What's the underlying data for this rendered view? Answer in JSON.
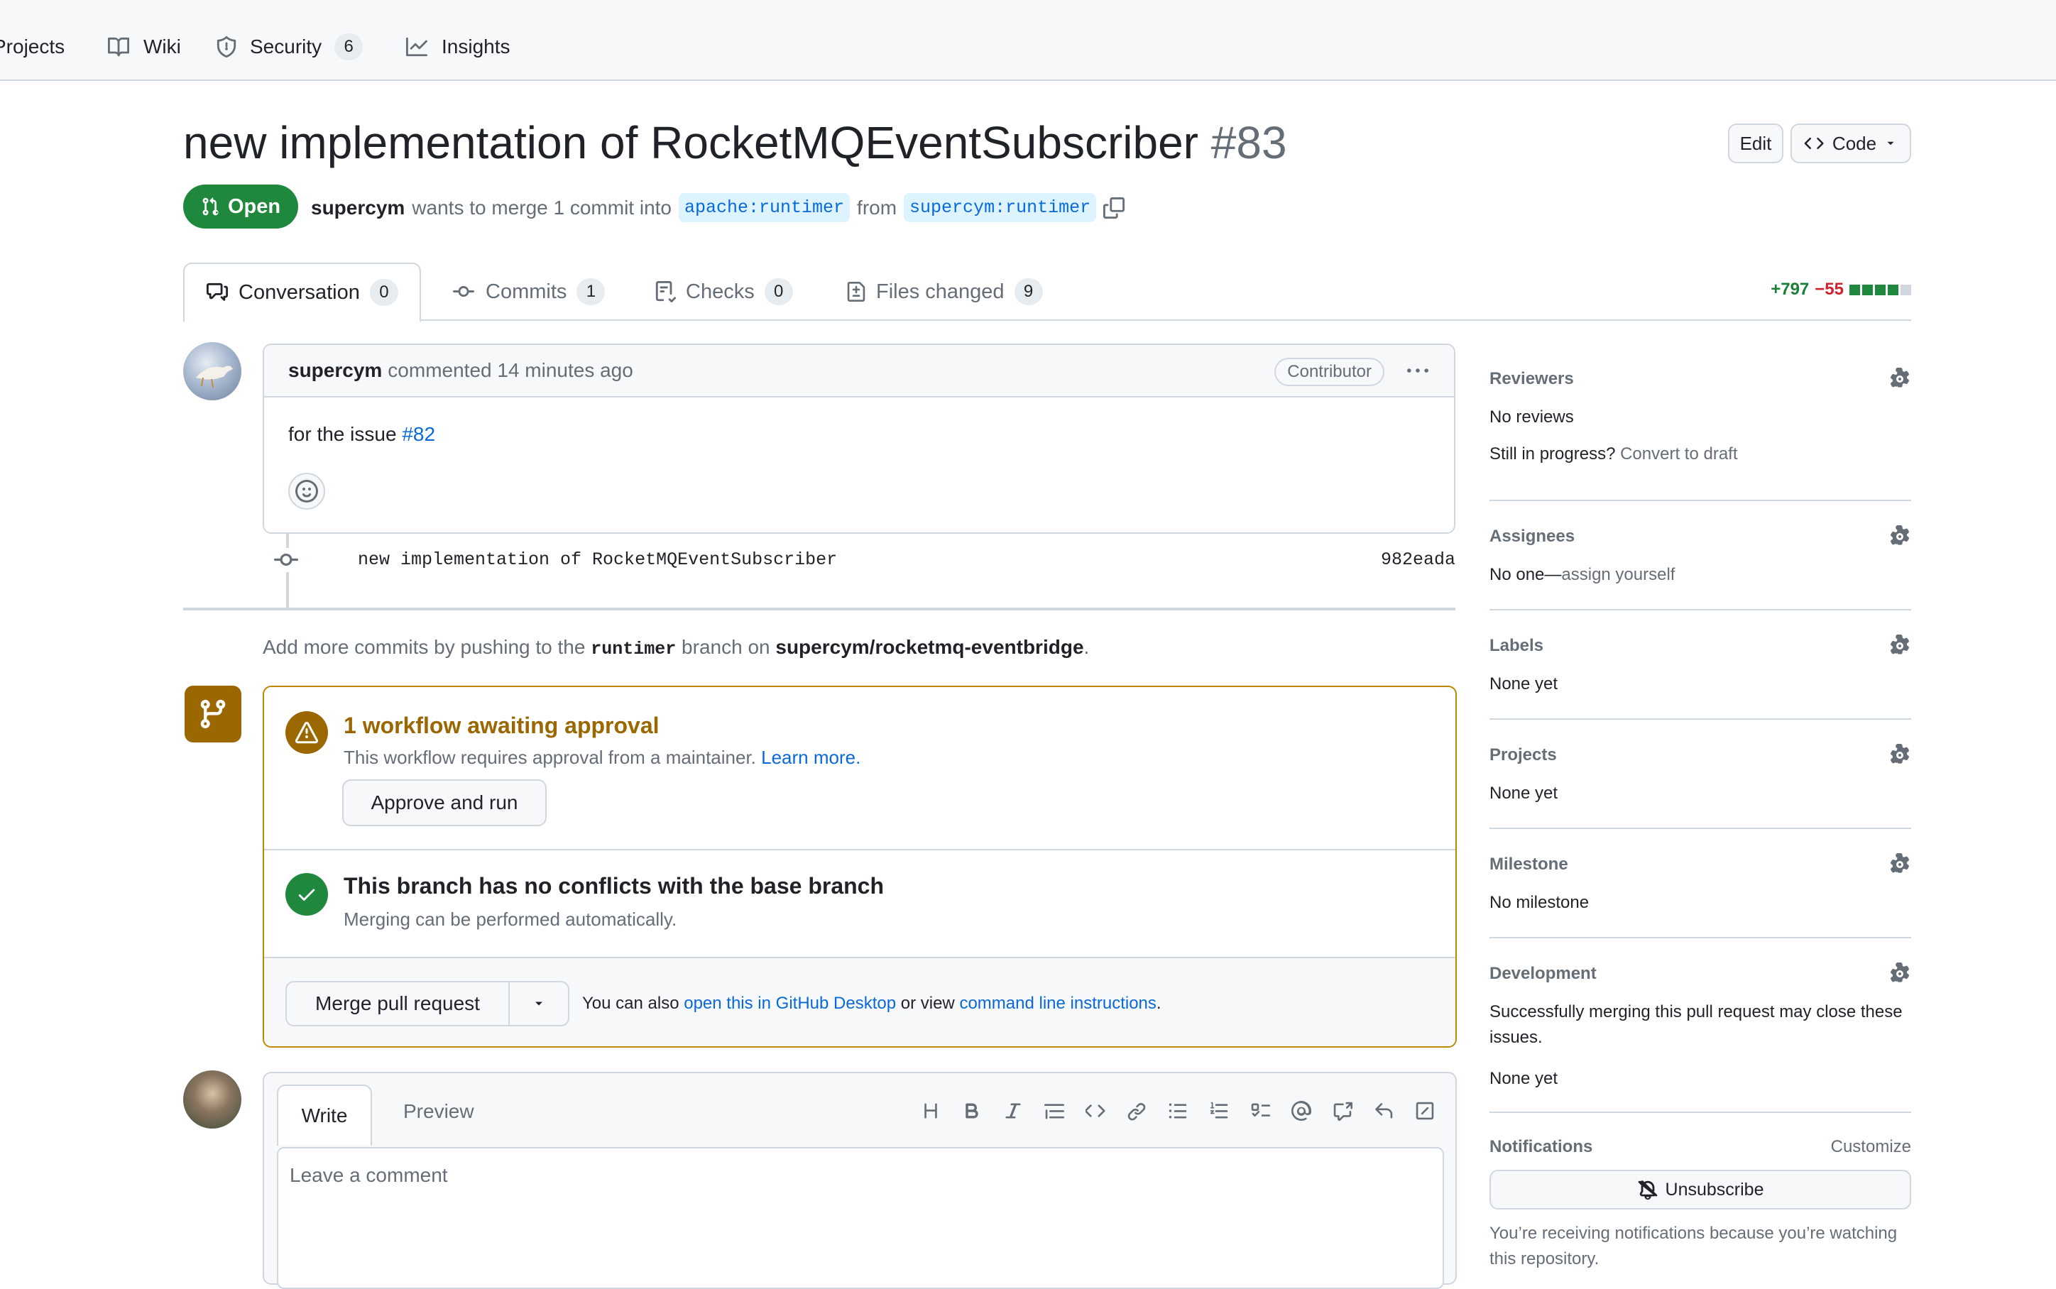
{
  "repo_nav": {
    "projects": "Projects",
    "wiki": "Wiki",
    "security": "Security",
    "security_count": "6",
    "insights": "Insights"
  },
  "pr": {
    "title": "new implementation of RocketMQEventSubscriber",
    "number": "#83",
    "edit_label": "Edit",
    "code_label": "Code",
    "state": "Open",
    "author": "supercym",
    "merge_text": "wants to merge 1 commit into",
    "base_branch": "apache:runtimer",
    "from_text": "from",
    "head_branch": "supercym:runtimer"
  },
  "tabs": [
    {
      "label": "Conversation",
      "count": "0"
    },
    {
      "label": "Commits",
      "count": "1"
    },
    {
      "label": "Checks",
      "count": "0"
    },
    {
      "label": "Files changed",
      "count": "9"
    }
  ],
  "diffstat": {
    "added": "+797",
    "removed": "−55",
    "blocks": [
      1,
      1,
      1,
      1,
      0
    ]
  },
  "comment": {
    "author": "supercym",
    "meta": "commented 14 minutes ago",
    "badge": "Contributor",
    "body_text": "for the issue",
    "issue_link": "#82"
  },
  "commit": {
    "message": "new implementation of RocketMQEventSubscriber",
    "sha": "982eada"
  },
  "hint": {
    "pre": "Add more commits by pushing to the",
    "branch": "runtimer",
    "mid": "branch on",
    "repo": "supercym/rocketmq-eventbridge",
    "end": "."
  },
  "mergebox": {
    "workflow_title": "1 workflow awaiting approval",
    "workflow_sub": "This workflow requires approval from a maintainer.",
    "learn_more": "Learn more.",
    "approve_label": "Approve and run",
    "conflict_title": "This branch has no conflicts with the base branch",
    "conflict_sub": "Merging can be performed automatically.",
    "merge_label": "Merge pull request",
    "also_text": "You can also",
    "desktop_link": "open this in GitHub Desktop",
    "or_view": "or view",
    "cli_link": "command line instructions",
    "period": "."
  },
  "sidebar": {
    "reviewers": {
      "heading": "Reviewers",
      "value": "No reviews",
      "progress_q": "Still in progress?",
      "progress_link": "Convert to draft"
    },
    "assignees": {
      "heading": "Assignees",
      "value_pre": "No one—",
      "value_link": "assign yourself"
    },
    "labels": {
      "heading": "Labels",
      "value": "None yet"
    },
    "projects": {
      "heading": "Projects",
      "value": "None yet"
    },
    "milestone": {
      "heading": "Milestone",
      "value": "No milestone"
    },
    "development": {
      "heading": "Development",
      "desc": "Successfully merging this pull request may close these issues.",
      "value": "None yet"
    },
    "notifications": {
      "heading": "Notifications",
      "customize": "Customize",
      "unsubscribe": "Unsubscribe",
      "reason": "You’re receiving notifications because you’re watching this repository."
    }
  },
  "composer": {
    "write": "Write",
    "preview": "Preview",
    "placeholder": "Leave a comment"
  }
}
